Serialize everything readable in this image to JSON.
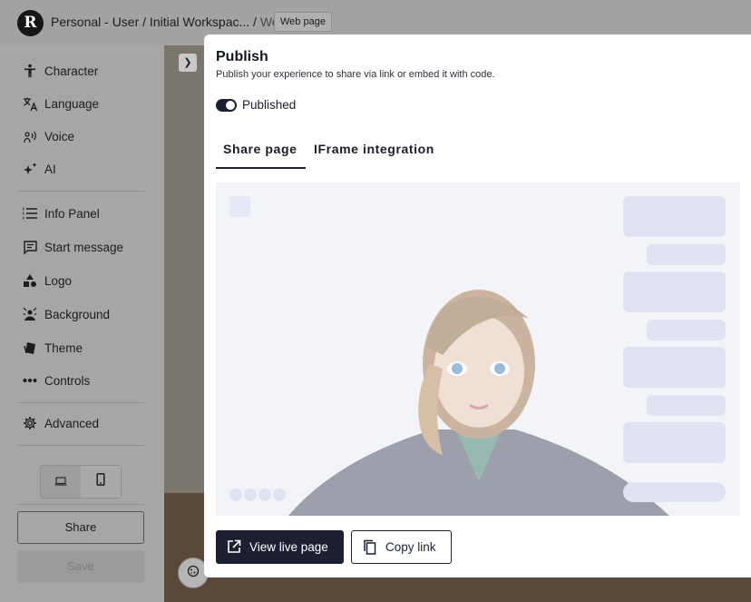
{
  "app": {
    "logo_letter": "R",
    "breadcrumb_path": "Personal - User / Initial Workspac... / ",
    "breadcrumb_current": "Web",
    "breadcrumb_tag": "Web page"
  },
  "sidebar": {
    "items": [
      {
        "label": "Character",
        "icon": "person-icon"
      },
      {
        "label": "Language",
        "icon": "translate-icon"
      },
      {
        "label": "Voice",
        "icon": "voice-icon"
      },
      {
        "label": "AI",
        "icon": "sparkle-icon"
      },
      {
        "label": "Info Panel",
        "icon": "list-icon"
      },
      {
        "label": "Start message",
        "icon": "message-icon"
      },
      {
        "label": "Logo",
        "icon": "shapes-icon"
      },
      {
        "label": "Background",
        "icon": "background-icon"
      },
      {
        "label": "Theme",
        "icon": "theme-icon"
      },
      {
        "label": "Controls",
        "icon": "dots-icon"
      },
      {
        "label": "Advanced",
        "icon": "gear-icon"
      }
    ],
    "device_options": [
      "desktop-icon",
      "mobile-icon"
    ],
    "share_label": "Share",
    "save_label": "Save"
  },
  "modal": {
    "title": "Publish",
    "subtitle": "Publish your experience to share via link or embed it with code.",
    "toggle_label": "Published",
    "toggle_on": true,
    "tabs": [
      {
        "label": "Share page",
        "active": true
      },
      {
        "label": "IFrame integration",
        "active": false
      }
    ],
    "view_live_label": "View live page",
    "copy_link_label": "Copy link"
  },
  "colors": {
    "accent": "#1d2033",
    "preview_bg": "#f3f4f8",
    "placeholder": "#dfe3f1",
    "overlay": "#a6a6a6"
  }
}
